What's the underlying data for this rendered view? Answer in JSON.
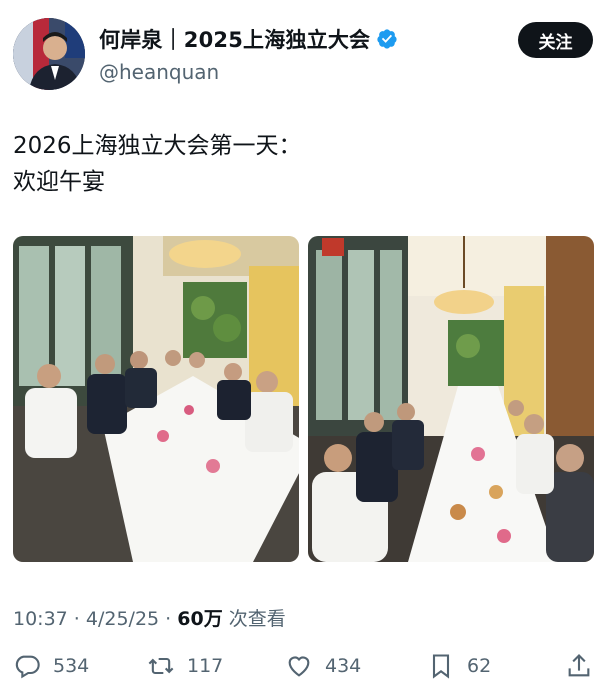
{
  "author": {
    "display_name": "何岸泉｜2025上海独立大会",
    "handle": "@heanquan",
    "follow_label": "关注"
  },
  "tweet": {
    "text": "2026上海独立大会第一天：\n欢迎午宴"
  },
  "meta": {
    "time": "10:37 · 4/25/25 · ",
    "views": "60万",
    "views_label": " 次查看"
  },
  "actions": {
    "replies": "534",
    "reposts": "117",
    "likes": "434",
    "bookmarks": "62"
  },
  "colors": {
    "text": "#0f1419",
    "secondary": "#536471",
    "verified": "#1d9bf0"
  }
}
